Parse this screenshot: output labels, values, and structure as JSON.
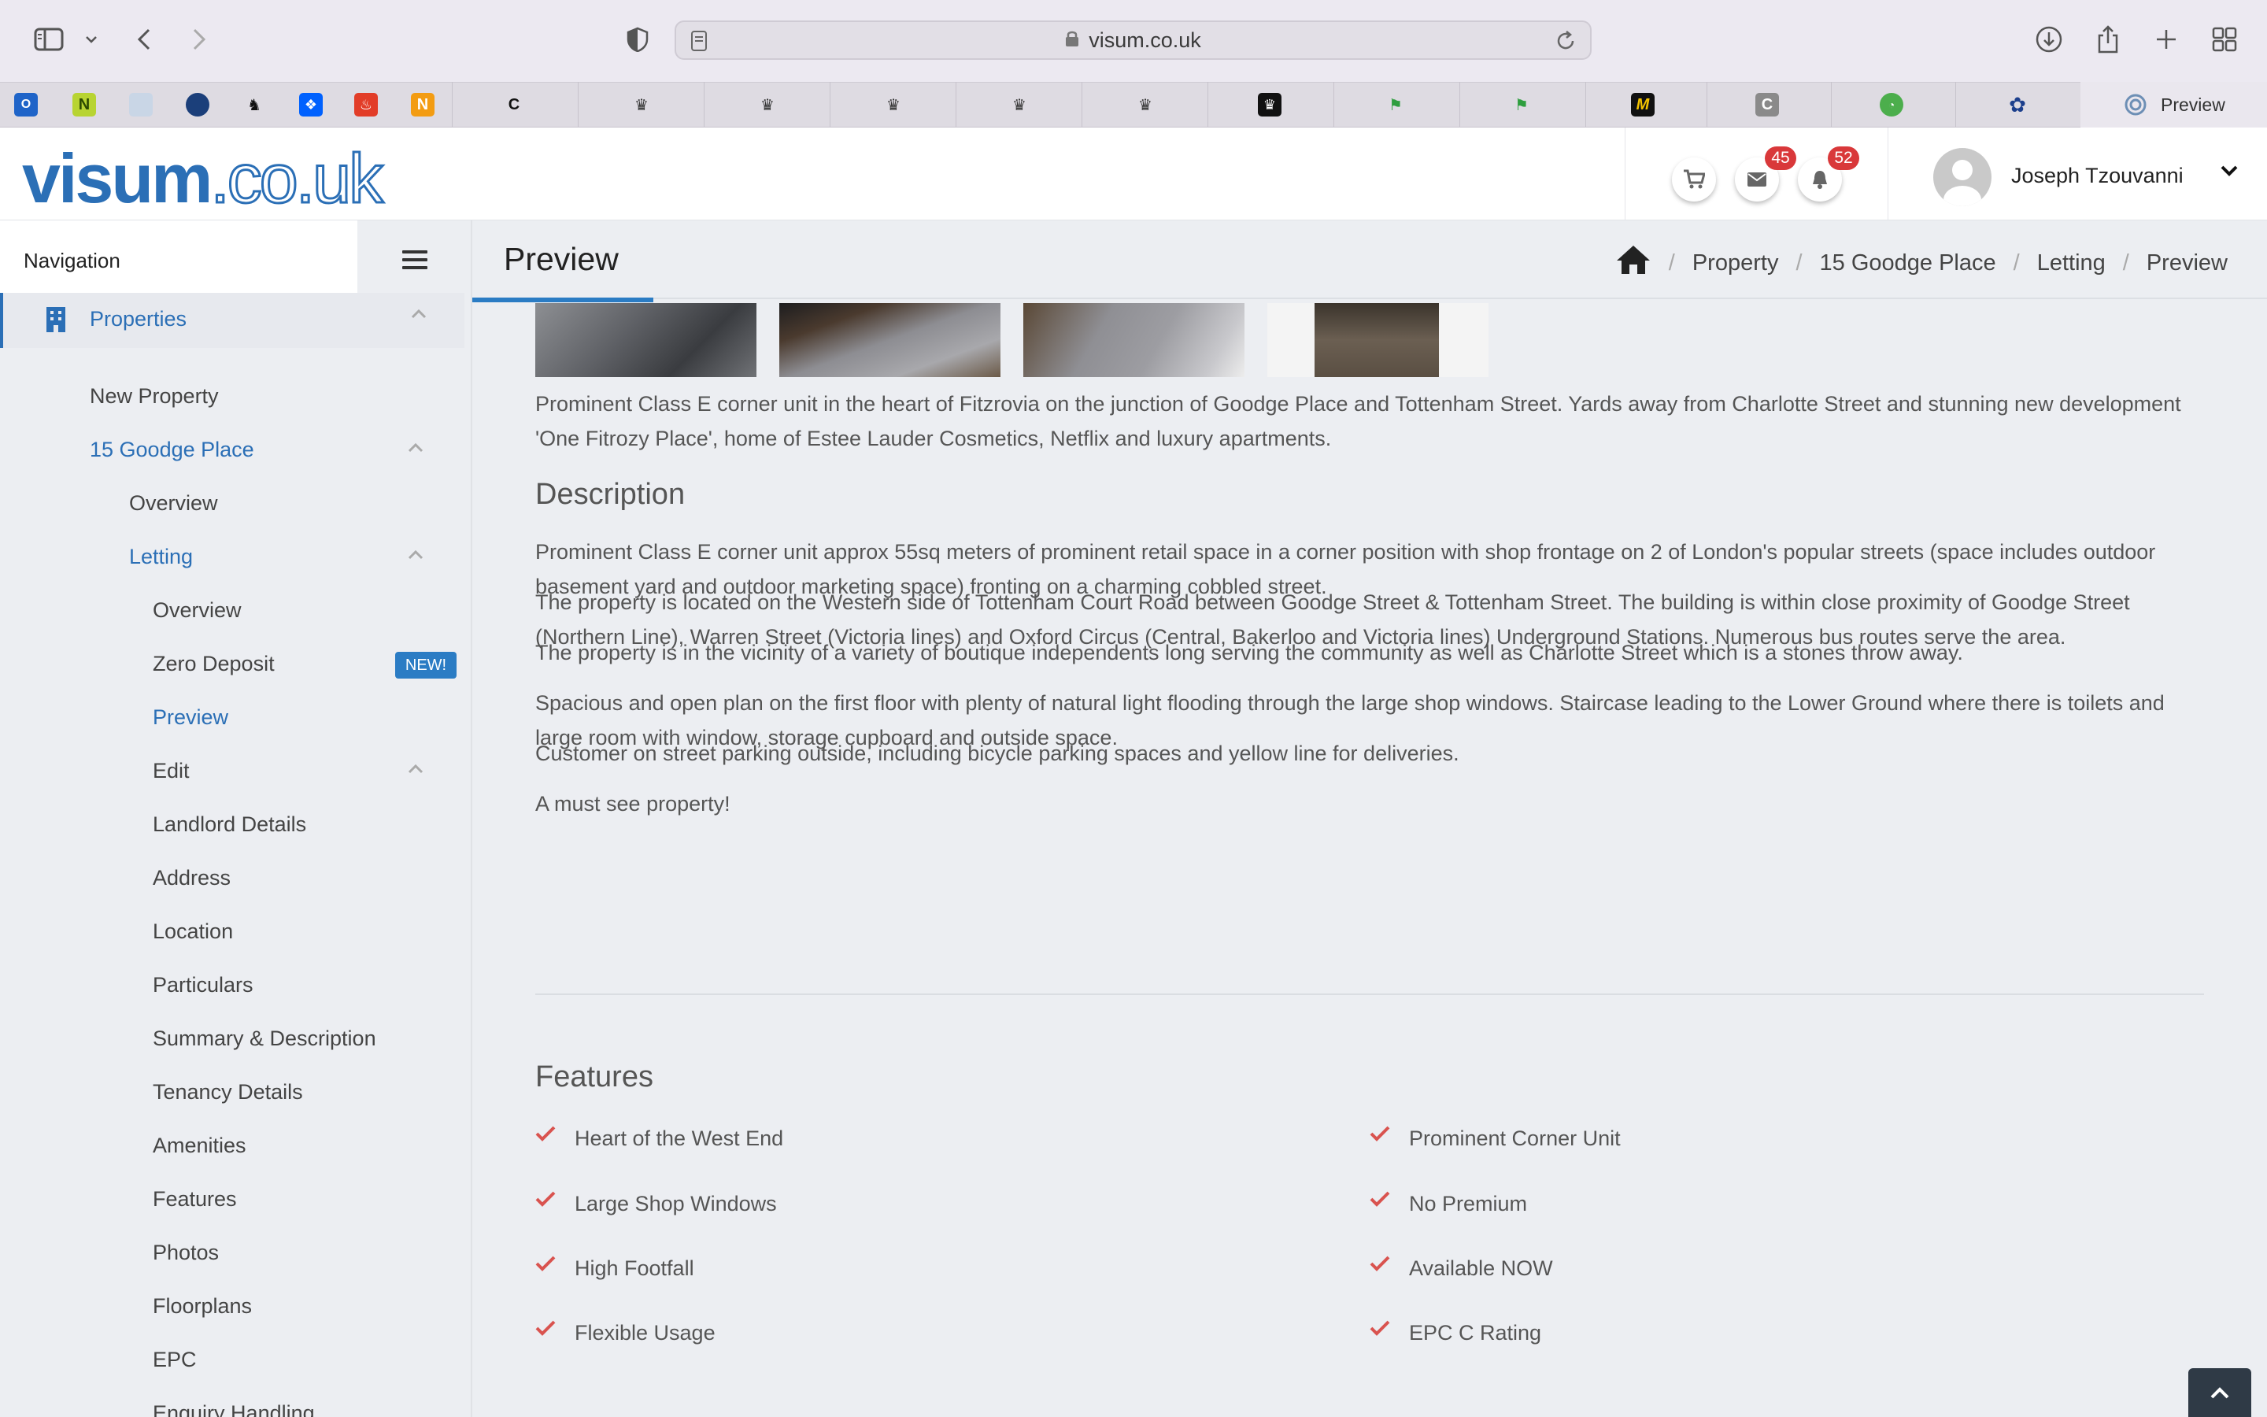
{
  "browser": {
    "url": "visum.co.uk",
    "active_tab_label": "Preview",
    "bookmark_letters": {
      "n": "N",
      "n2": "N",
      "c": "C",
      "m": "M"
    }
  },
  "header": {
    "logo_bold": "visum",
    "logo_outline": ".co.uk",
    "mail_count": "45",
    "notify_count": "52",
    "user_name": "Joseph Tzouvanni"
  },
  "sidebar": {
    "nav_title": "Navigation",
    "items": {
      "properties": "Properties",
      "new_property": "New Property",
      "property_name": "15 Goodge Place",
      "overview": "Overview",
      "letting": "Letting",
      "letting_overview": "Overview",
      "zero_deposit": "Zero Deposit",
      "preview": "Preview",
      "edit": "Edit",
      "landlord_details": "Landlord Details",
      "address": "Address",
      "location": "Location",
      "particulars": "Particulars",
      "summary_description": "Summary & Description",
      "tenancy_details": "Tenancy Details",
      "amenities": "Amenities",
      "features": "Features",
      "photos": "Photos",
      "floorplans": "Floorplans",
      "epc": "EPC",
      "enquiry_handling": "Enquiry Handling"
    },
    "new_badge": "NEW!"
  },
  "page": {
    "title": "Preview",
    "breadcrumbs": [
      "Property",
      "15 Goodge Place",
      "Letting",
      "Preview"
    ]
  },
  "summary": "Prominent Class E corner unit in the heart of Fitzrovia on the junction of Goodge Place and Tottenham Street. Yards away from Charlotte Street and stunning new development 'One Fitrozy Place', home of Estee Lauder Cosmetics, Netflix and luxury apartments.",
  "description": {
    "heading": "Description",
    "paragraphs": [
      "Prominent Class E corner unit approx 55sq meters of prominent retail space in a corner position with shop frontage on 2 of London's popular streets (space includes outdoor basement yard and outdoor marketing space) fronting on a charming cobbled street.",
      "The property is located on the Western side of Tottenham Court Road between Goodge Street & Tottenham Street. The building is within close proximity of Goodge Street (Northern Line), Warren Street (Victoria lines) and Oxford Circus (Central, Bakerloo and Victoria lines) Underground Stations. Numerous bus routes serve the area.",
      "The property is in the vicinity of a variety of boutique independents long serving the community as well as Charlotte Street which is a stones throw away.",
      "Spacious and open plan on the first floor with plenty of natural light flooding through the large shop windows. Staircase leading to the Lower Ground where there is toilets and large room with window, storage cupboard and outside space.",
      "Customer on street parking outside, including bicycle parking spaces and yellow line for deliveries.",
      "A must see property!"
    ]
  },
  "features": {
    "heading": "Features",
    "left": [
      "Heart of the West End",
      "Large Shop Windows",
      "High Footfall",
      "Flexible Usage"
    ],
    "right": [
      "Prominent Corner Unit",
      "No Premium",
      "Available NOW",
      "EPC C Rating"
    ]
  },
  "colors": {
    "brand_blue": "#2b6fb6",
    "badge_red": "#d9383a",
    "check_red": "#d9534f"
  }
}
